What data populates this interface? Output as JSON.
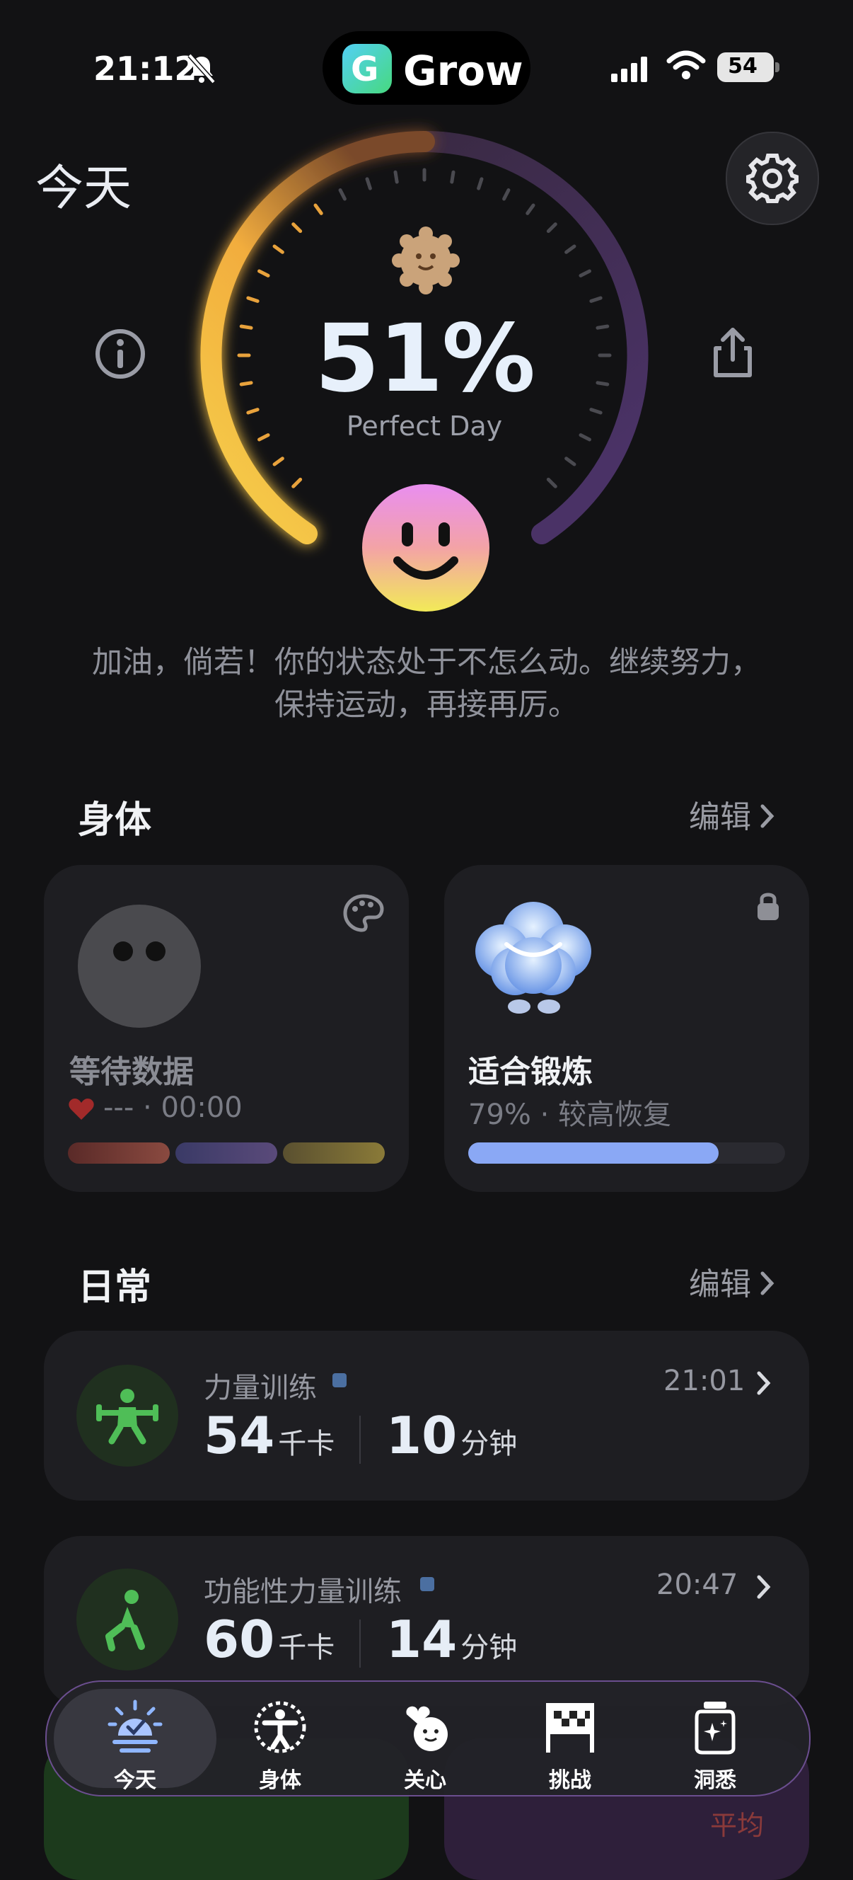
{
  "status_bar": {
    "time": "21:12",
    "battery": "54"
  },
  "island": {
    "app_name": "Grow",
    "logo_letter": "G"
  },
  "header": {
    "title": "今天"
  },
  "perfect_day": {
    "percent": "51%",
    "label": "Perfect Day",
    "progress": 0.51
  },
  "message": "加油，倘若！你的状态处于不怎么动。继续努力，保持运动，再接再厉。",
  "body_section": {
    "title": "身体",
    "edit_label": "编辑",
    "cards": [
      {
        "title": "等待数据",
        "subtitle": "--- · 00:00"
      },
      {
        "title": "适合锻炼",
        "subtitle": "79% · 较高恢复",
        "progress": 0.79
      }
    ]
  },
  "daily_section": {
    "title": "日常",
    "edit_label": "编辑",
    "items": [
      {
        "name": "力量训练",
        "time": "21:01",
        "calories": "54",
        "calories_unit": "千卡",
        "duration": "10",
        "duration_unit": "分钟"
      },
      {
        "name": "功能性力量训练",
        "time": "20:47",
        "calories": "60",
        "calories_unit": "千卡",
        "duration": "14",
        "duration_unit": "分钟"
      }
    ]
  },
  "background_peek": {
    "text": "平均"
  },
  "tabs": [
    {
      "label": "今天",
      "icon": "sun-check-icon",
      "active": true
    },
    {
      "label": "身体",
      "icon": "body-icon",
      "active": false
    },
    {
      "label": "关心",
      "icon": "care-icon",
      "active": false
    },
    {
      "label": "挑战",
      "icon": "flag-icon",
      "active": false
    },
    {
      "label": "洞悉",
      "icon": "insight-jar-icon",
      "active": false
    }
  ],
  "colors": {
    "background": "#121214",
    "ring_yellow": "#f4c33f",
    "ring_purple": "#3a2a55",
    "readiness_bar": "#8aa8f5",
    "accent_green": "#4fbe57"
  }
}
